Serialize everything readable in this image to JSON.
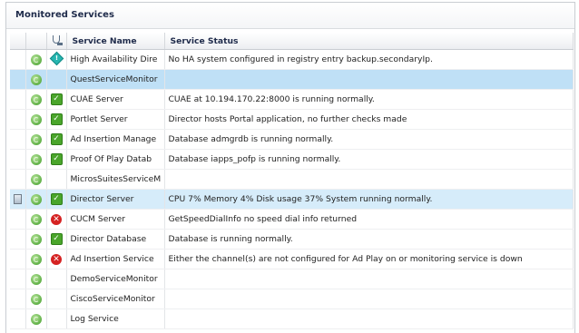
{
  "panel": {
    "title": "Monitored Services"
  },
  "columns": {
    "name": "Service Name",
    "status": "Service Status"
  },
  "rows": [
    {
      "name": "High Availability Dire",
      "status": "No HA system configured in registry entry backup.secondaryIp.",
      "state": "warning"
    },
    {
      "name": "QuestServiceMonitor",
      "status": "",
      "state": "none"
    },
    {
      "name": "CUAE Server",
      "status": "CUAE at 10.194.170.22:8000 is running normally.",
      "state": "ok"
    },
    {
      "name": "Portlet Server",
      "status": "Director hosts Portal application, no further checks made",
      "state": "ok"
    },
    {
      "name": "Ad Insertion Manage",
      "status": "Database admgrdb is running normally.",
      "state": "ok"
    },
    {
      "name": "Proof Of Play Datab",
      "status": "Database iapps_pofp is running normally.",
      "state": "ok"
    },
    {
      "name": "MicrosSuitesServiceM",
      "status": "",
      "state": "none"
    },
    {
      "name": "Director Server",
      "status": "CPU 7% Memory 4% Disk usage 37% System running normally.",
      "state": "ok"
    },
    {
      "name": "CUCM Server",
      "status": "GetSpeedDialInfo no speed dial info returned",
      "state": "error"
    },
    {
      "name": "Director Database",
      "status": "Database is running normally.",
      "state": "ok"
    },
    {
      "name": "Ad Insertion Service",
      "status": "Either the channel(s) are not configured for Ad Play on or monitoring service is down",
      "state": "error"
    },
    {
      "name": "DemoServiceMonitor",
      "status": "",
      "state": "none"
    },
    {
      "name": "CiscoServiceMonitor",
      "status": "",
      "state": "none"
    },
    {
      "name": "Log Service",
      "status": "",
      "state": "none"
    }
  ]
}
